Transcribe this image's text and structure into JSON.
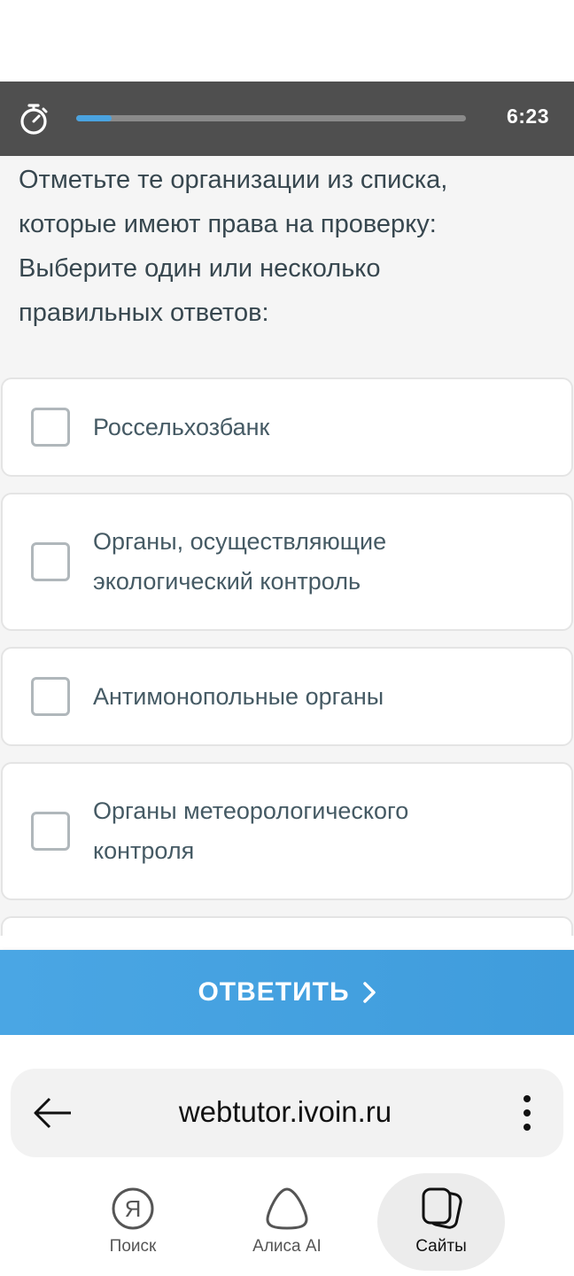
{
  "timer": {
    "icon": "stopwatch-icon",
    "progress_fraction": 0.09,
    "time_left": "6:23",
    "progress_color": "#4aa3e0"
  },
  "question": {
    "line1": "Отметьте те организации из списка,",
    "line2": "которые имеют права на проверку:",
    "line3": "Выберите один или несколько",
    "line4": "правильных ответов:"
  },
  "options": [
    {
      "label": "Россельхозбанк",
      "checked": false
    },
    {
      "label_line1": "Органы, осуществляющие",
      "label_line2": "экологический контроль",
      "checked": false
    },
    {
      "label": "Антимонопольные органы",
      "checked": false
    },
    {
      "label_line1": "Органы метеорологического",
      "label_line2": "контроля",
      "checked": false
    }
  ],
  "answer_button": {
    "label": "ОТВЕТИТЬ",
    "icon": "chevron-right-icon",
    "color": "#4aa6e4"
  },
  "browser": {
    "url": "webtutor.ivoin.ru",
    "back_icon": "arrow-left-icon",
    "menu_icon": "kebab-menu-icon"
  },
  "nav": [
    {
      "label": "Поиск",
      "icon": "yandex-logo-icon"
    },
    {
      "label": "Алиса AI",
      "icon": "alice-icon"
    },
    {
      "label": "Сайты",
      "icon": "tabs-icon",
      "active": true
    }
  ]
}
